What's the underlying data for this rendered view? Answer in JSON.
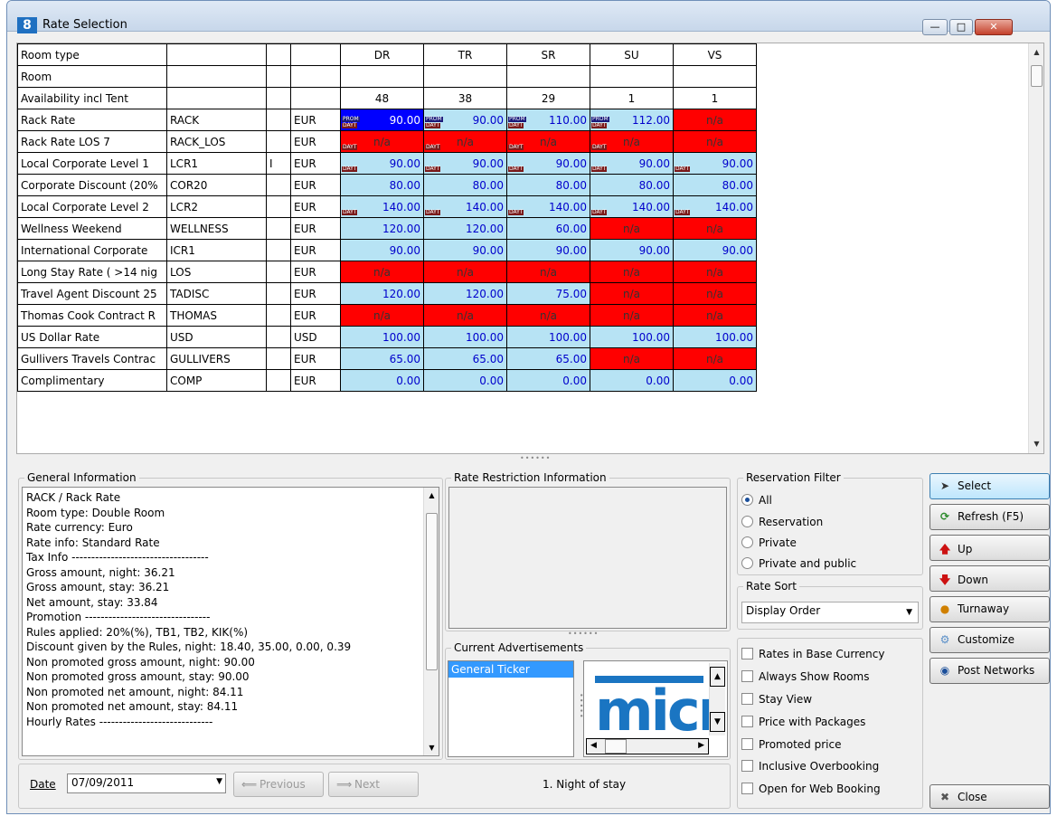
{
  "window": {
    "title": "Rate Selection",
    "icon_text": "8"
  },
  "grid": {
    "header_rows": [
      {
        "label": "Room type",
        "values": [
          "DR",
          "TR",
          "SR",
          "SU",
          "VS"
        ]
      },
      {
        "label": "Room",
        "values": [
          "",
          "",
          "",
          "",
          ""
        ]
      },
      {
        "label": "Availability incl Tent",
        "values": [
          "48",
          "38",
          "29",
          "1",
          "1"
        ]
      }
    ],
    "rows": [
      {
        "name": "Rack Rate",
        "code": "RACK",
        "i": "",
        "cur": "EUR",
        "cells": [
          {
            "v": "90.00",
            "st": "sel",
            "tags": [
              "PROM",
              "DAYT"
            ]
          },
          {
            "v": "90.00",
            "st": "ok",
            "tags": [
              "PROM",
              "DAYT"
            ]
          },
          {
            "v": "110.00",
            "st": "ok",
            "tags": [
              "PROM",
              "DAYT"
            ]
          },
          {
            "v": "112.00",
            "st": "ok",
            "tags": [
              "PROM",
              "DAYT"
            ]
          },
          {
            "v": "n/a",
            "st": "na",
            "tags": []
          }
        ]
      },
      {
        "name": "Rack Rate LOS 7",
        "code": "RACK_LOS",
        "i": "",
        "cur": "EUR",
        "cells": [
          {
            "v": "n/a",
            "st": "na",
            "tags": [
              "DAYT"
            ]
          },
          {
            "v": "n/a",
            "st": "na",
            "tags": [
              "DAYT"
            ]
          },
          {
            "v": "n/a",
            "st": "na",
            "tags": [
              "DAYT"
            ]
          },
          {
            "v": "n/a",
            "st": "na",
            "tags": [
              "DAYT"
            ]
          },
          {
            "v": "n/a",
            "st": "na",
            "tags": []
          }
        ]
      },
      {
        "name": "Local Corporate Level 1",
        "code": "LCR1",
        "i": "I",
        "cur": "EUR",
        "cells": [
          {
            "v": "90.00",
            "st": "ok",
            "tags": [
              "DAYT"
            ]
          },
          {
            "v": "90.00",
            "st": "ok",
            "tags": [
              "DAYT"
            ]
          },
          {
            "v": "90.00",
            "st": "ok",
            "tags": [
              "DAYT"
            ]
          },
          {
            "v": "90.00",
            "st": "ok",
            "tags": [
              "DAYT"
            ]
          },
          {
            "v": "90.00",
            "st": "ok",
            "tags": [
              "DAYT"
            ]
          }
        ]
      },
      {
        "name": "Corporate Discount (20%",
        "code": "COR20",
        "i": "",
        "cur": "EUR",
        "cells": [
          {
            "v": "80.00",
            "st": "ok",
            "tags": []
          },
          {
            "v": "80.00",
            "st": "ok",
            "tags": []
          },
          {
            "v": "80.00",
            "st": "ok",
            "tags": []
          },
          {
            "v": "80.00",
            "st": "ok",
            "tags": []
          },
          {
            "v": "80.00",
            "st": "ok",
            "tags": []
          }
        ]
      },
      {
        "name": "Local Corporate Level 2",
        "code": "LCR2",
        "i": "",
        "cur": "EUR",
        "cells": [
          {
            "v": "140.00",
            "st": "ok",
            "tags": [
              "DAYT"
            ]
          },
          {
            "v": "140.00",
            "st": "ok",
            "tags": [
              "DAYT"
            ]
          },
          {
            "v": "140.00",
            "st": "ok",
            "tags": [
              "DAYT"
            ]
          },
          {
            "v": "140.00",
            "st": "ok",
            "tags": [
              "DAYT"
            ]
          },
          {
            "v": "140.00",
            "st": "ok",
            "tags": [
              "DAYT"
            ]
          }
        ]
      },
      {
        "name": "Wellness Weekend",
        "code": "WELLNESS",
        "i": "",
        "cur": "EUR",
        "cells": [
          {
            "v": "120.00",
            "st": "ok",
            "tags": []
          },
          {
            "v": "120.00",
            "st": "ok",
            "tags": []
          },
          {
            "v": "60.00",
            "st": "ok",
            "tags": []
          },
          {
            "v": "n/a",
            "st": "na",
            "tags": []
          },
          {
            "v": "n/a",
            "st": "na",
            "tags": []
          }
        ]
      },
      {
        "name": "International Corporate",
        "code": "ICR1",
        "i": "",
        "cur": "EUR",
        "cells": [
          {
            "v": "90.00",
            "st": "ok",
            "tags": []
          },
          {
            "v": "90.00",
            "st": "ok",
            "tags": []
          },
          {
            "v": "90.00",
            "st": "ok",
            "tags": []
          },
          {
            "v": "90.00",
            "st": "ok",
            "tags": []
          },
          {
            "v": "90.00",
            "st": "ok",
            "tags": []
          }
        ]
      },
      {
        "name": "Long Stay Rate ( >14 nig",
        "code": "LOS",
        "i": "",
        "cur": "EUR",
        "cells": [
          {
            "v": "n/a",
            "st": "na",
            "tags": []
          },
          {
            "v": "n/a",
            "st": "na",
            "tags": []
          },
          {
            "v": "n/a",
            "st": "na",
            "tags": []
          },
          {
            "v": "n/a",
            "st": "na",
            "tags": []
          },
          {
            "v": "n/a",
            "st": "na",
            "tags": []
          }
        ]
      },
      {
        "name": "Travel Agent Discount 25",
        "code": "TADISC",
        "i": "",
        "cur": "EUR",
        "cells": [
          {
            "v": "120.00",
            "st": "ok",
            "tags": []
          },
          {
            "v": "120.00",
            "st": "ok",
            "tags": []
          },
          {
            "v": "75.00",
            "st": "ok",
            "tags": []
          },
          {
            "v": "n/a",
            "st": "na",
            "tags": []
          },
          {
            "v": "n/a",
            "st": "na",
            "tags": []
          }
        ]
      },
      {
        "name": "Thomas Cook Contract R",
        "code": "THOMAS",
        "i": "",
        "cur": "EUR",
        "cells": [
          {
            "v": "n/a",
            "st": "na",
            "tags": []
          },
          {
            "v": "n/a",
            "st": "na",
            "tags": []
          },
          {
            "v": "n/a",
            "st": "na",
            "tags": []
          },
          {
            "v": "n/a",
            "st": "na",
            "tags": []
          },
          {
            "v": "n/a",
            "st": "na",
            "tags": []
          }
        ]
      },
      {
        "name": "US Dollar Rate",
        "code": "USD",
        "i": "",
        "cur": "USD",
        "cells": [
          {
            "v": "100.00",
            "st": "ok",
            "tags": []
          },
          {
            "v": "100.00",
            "st": "ok",
            "tags": []
          },
          {
            "v": "100.00",
            "st": "ok",
            "tags": []
          },
          {
            "v": "100.00",
            "st": "ok",
            "tags": []
          },
          {
            "v": "100.00",
            "st": "ok",
            "tags": []
          }
        ]
      },
      {
        "name": "Gullivers Travels Contrac",
        "code": "GULLIVERS",
        "i": "",
        "cur": "EUR",
        "cells": [
          {
            "v": "65.00",
            "st": "ok",
            "tags": []
          },
          {
            "v": "65.00",
            "st": "ok",
            "tags": []
          },
          {
            "v": "65.00",
            "st": "ok",
            "tags": []
          },
          {
            "v": "n/a",
            "st": "na",
            "tags": []
          },
          {
            "v": "n/a",
            "st": "na",
            "tags": []
          }
        ]
      },
      {
        "name": "Complimentary",
        "code": "COMP",
        "i": "",
        "cur": "EUR",
        "cells": [
          {
            "v": "0.00",
            "st": "ok",
            "tags": []
          },
          {
            "v": "0.00",
            "st": "ok",
            "tags": []
          },
          {
            "v": "0.00",
            "st": "ok",
            "tags": []
          },
          {
            "v": "0.00",
            "st": "ok",
            "tags": []
          },
          {
            "v": "0.00",
            "st": "ok",
            "tags": []
          }
        ]
      }
    ]
  },
  "general_info": {
    "title": "General Information",
    "lines": [
      "RACK / Rack Rate",
      "Room type: Double Room",
      "Rate currency: Euro",
      "Rate info: Standard Rate",
      "Tax Info -----------------------------------",
      "Gross amount, night: 36.21",
      "Gross amount, stay:  36.21",
      "Net amount, stay:   33.84",
      "Promotion --------------------------------",
      "Rules applied: 20%(%), TB1, TB2, KIK(%)",
      "Discount given by the Rules, night: 18.40, 35.00, 0.00, 0.39",
      "Non promoted gross amount, night: 90.00",
      "Non promoted gross amount, stay:  90.00",
      "Non promoted net amount, night:   84.11",
      "Non promoted net amount, stay:   84.11",
      "Hourly Rates -----------------------------"
    ]
  },
  "date": {
    "label": "Date",
    "value": "07/09/2011"
  },
  "nav": {
    "previous": "Previous",
    "next": "Next",
    "night_of_stay": "1. Night of stay"
  },
  "rate_restriction": {
    "title": "Rate Restriction Information"
  },
  "advertisements": {
    "title": "Current Advertisements",
    "items": [
      "General Ticker"
    ],
    "banner_text": "micr"
  },
  "reservation_filter": {
    "title": "Reservation Filter",
    "options": [
      "All",
      "Reservation",
      "Private",
      "Private and public"
    ],
    "selected": "All"
  },
  "rate_sort": {
    "title": "Rate Sort",
    "value": "Display Order"
  },
  "checkboxes": [
    "Rates in Base Currency",
    "Always Show Rooms",
    "Stay View",
    "Price with Packages",
    "Promoted price",
    "Inclusive Overbooking",
    "Open for Web Booking"
  ],
  "buttons": {
    "select": "Select",
    "refresh": "Refresh (F5)",
    "up": "Up",
    "down": "Down",
    "turnaway": "Turnaway",
    "customize": "Customize",
    "post_networks": "Post Networks",
    "close": "Close"
  },
  "colors": {
    "available": "#b7e3f4",
    "not_available": "#ff0000",
    "selected": "#0000ff",
    "value_text": "#0000cc"
  },
  "icons": {
    "select": "cursor-icon",
    "refresh": "refresh-icon",
    "up": "arrow-up-icon",
    "down": "arrow-down-icon",
    "turnaway": "turnaway-icon",
    "customize": "gear-icon",
    "post_networks": "globe-icon",
    "close": "close-icon"
  }
}
